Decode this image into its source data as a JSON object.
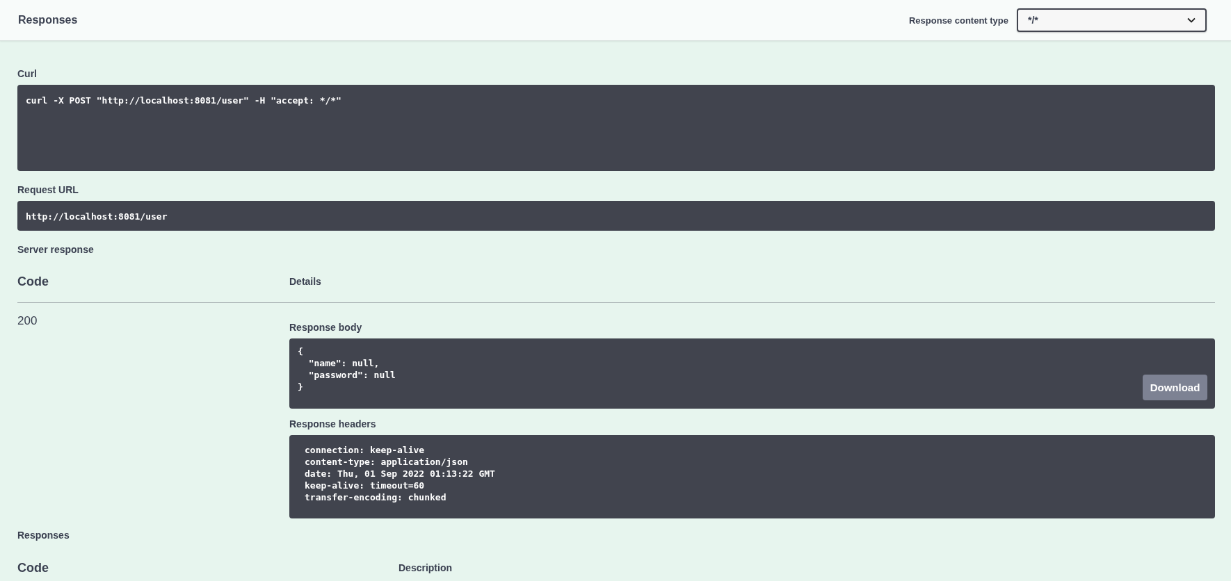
{
  "header": {
    "title": "Responses",
    "content_type_label": "Response content type",
    "content_type": {
      "value": "*/*"
    }
  },
  "curl": {
    "label": "Curl",
    "command": "curl -X POST \"http://localhost:8081/user\" -H \"accept: */*\""
  },
  "request_url": {
    "label": "Request URL",
    "value": "http://localhost:8081/user"
  },
  "server_response": {
    "label": "Server response",
    "columns": [
      "Code",
      "Details"
    ],
    "rows": [
      {
        "code": "200",
        "body_label": "Response body",
        "body_lines": [
          "{",
          "  \"name\": null,",
          "  \"password\": null",
          "}"
        ],
        "download": "Download",
        "headers_label": "Response headers",
        "headers": [
          "connection: keep-alive",
          "content-type: application/json",
          "date: Thu, 01 Sep 2022 01:13:22 GMT",
          "keep-alive: timeout=60",
          "transfer-encoding: chunked"
        ]
      }
    ]
  },
  "responses": {
    "label": "Responses",
    "columns": [
      "Code",
      "Description"
    ]
  }
}
